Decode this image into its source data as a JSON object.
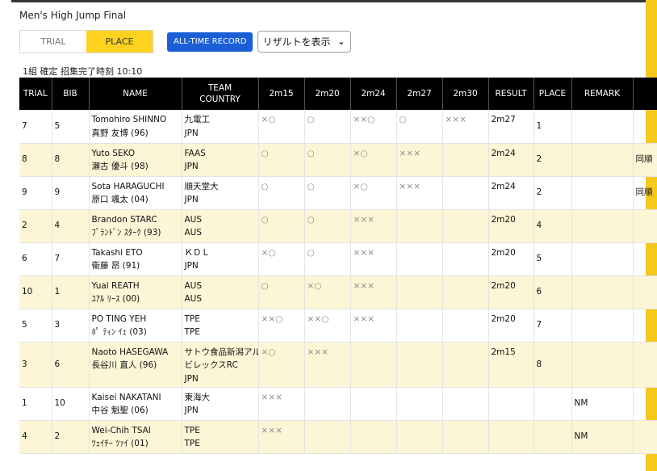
{
  "page_title": "Men's High Jump Final",
  "tabs": [
    {
      "label": "TRIAL",
      "active": false
    },
    {
      "label": "PLACE",
      "active": true
    }
  ],
  "all_time_record_label": "ALL-TIME RECORD",
  "result_select": {
    "selected": "リザルトを表示"
  },
  "status_line": "1組 確定 招集完了時刻 10:10",
  "columns": {
    "trial": "TRIAL",
    "bib": "BIB",
    "name": "NAME",
    "team_l1": "TEAM",
    "team_l2": "COUNTRY",
    "heights": [
      "2m15",
      "2m20",
      "2m24",
      "2m27",
      "2m30"
    ],
    "result": "RESULT",
    "place": "PLACE",
    "remark": "REMARK"
  },
  "rows": [
    {
      "trial": "7",
      "bib": "5",
      "name_en": "Tomohiro SHINNO",
      "name_jp": "真野 友博 (96)",
      "team": [
        "九電工",
        "JPN"
      ],
      "attempts": [
        "×○",
        "○",
        "××○",
        "○",
        "×××"
      ],
      "result": "2m27",
      "place": "1",
      "remark": "",
      "extra": ""
    },
    {
      "trial": "8",
      "bib": "8",
      "name_en": "Yuto SEKO",
      "name_jp": "瀬古 優斗 (98)",
      "team": [
        "FAAS",
        "JPN"
      ],
      "attempts": [
        "○",
        "○",
        "×○",
        "×××",
        ""
      ],
      "result": "2m24",
      "place": "2",
      "remark": "",
      "extra": "同順"
    },
    {
      "trial": "9",
      "bib": "9",
      "name_en": "Sota HARAGUCHI",
      "name_jp": "原口 颯太 (04)",
      "team": [
        "順天堂大",
        "JPN"
      ],
      "attempts": [
        "○",
        "○",
        "×○",
        "×××",
        ""
      ],
      "result": "2m24",
      "place": "2",
      "remark": "",
      "extra": "同順"
    },
    {
      "trial": "2",
      "bib": "4",
      "name_en": "Brandon STARC",
      "name_jp": "ﾌﾞﾗﾝﾄﾞﾝ ｽﾀｰｸ (93)",
      "team": [
        "AUS",
        "AUS"
      ],
      "attempts": [
        "○",
        "○",
        "×××",
        "",
        ""
      ],
      "result": "2m20",
      "place": "4",
      "remark": "",
      "extra": ""
    },
    {
      "trial": "6",
      "bib": "7",
      "name_en": "Takashi ETO",
      "name_jp": "衛藤 昂 (91)",
      "team": [
        "ＫＤＬ",
        "JPN"
      ],
      "attempts": [
        "×○",
        "○",
        "×××",
        "",
        ""
      ],
      "result": "2m20",
      "place": "5",
      "remark": "",
      "extra": ""
    },
    {
      "trial": "10",
      "bib": "1",
      "name_en": "Yual REATH",
      "name_jp": "ﾕｱﾙ ﾘｰｽ (00)",
      "team": [
        "AUS",
        "AUS"
      ],
      "attempts": [
        "○",
        "×○",
        "×××",
        "",
        ""
      ],
      "result": "2m20",
      "place": "6",
      "remark": "",
      "extra": ""
    },
    {
      "trial": "5",
      "bib": "3",
      "name_en": "PO TING YEH",
      "name_jp": "ﾎﾟ ﾃｨﾝ ｲｪ (03)",
      "team": [
        "TPE",
        "TPE"
      ],
      "attempts": [
        "××○",
        "××○",
        "×××",
        "",
        ""
      ],
      "result": "2m20",
      "place": "7",
      "remark": "",
      "extra": ""
    },
    {
      "trial": "3",
      "bib": "6",
      "name_en": "Naoto HASEGAWA",
      "name_jp": "長谷川 直人 (96)",
      "team": [
        "サトウ食品新潟アル",
        "ビレックスRC",
        "JPN"
      ],
      "attempts": [
        "×○",
        "×××",
        "",
        "",
        ""
      ],
      "result": "2m15",
      "place": "8",
      "remark": "",
      "extra": ""
    },
    {
      "trial": "1",
      "bib": "10",
      "name_en": "Kaisei NAKATANI",
      "name_jp": "中谷 魁聖 (06)",
      "team": [
        "東海大",
        "JPN"
      ],
      "attempts": [
        "×××",
        "",
        "",
        "",
        ""
      ],
      "result": "",
      "place": "",
      "remark": "NM",
      "extra": ""
    },
    {
      "trial": "4",
      "bib": "2",
      "name_en": "Wei-Chih TSAI",
      "name_jp": "ﾂｪｲﾁｰ ﾂｧｲ (01)",
      "team": [
        "TPE",
        "TPE"
      ],
      "attempts": [
        "×××",
        "",
        "",
        "",
        ""
      ],
      "result": "",
      "place": "",
      "remark": "NM",
      "extra": ""
    }
  ]
}
